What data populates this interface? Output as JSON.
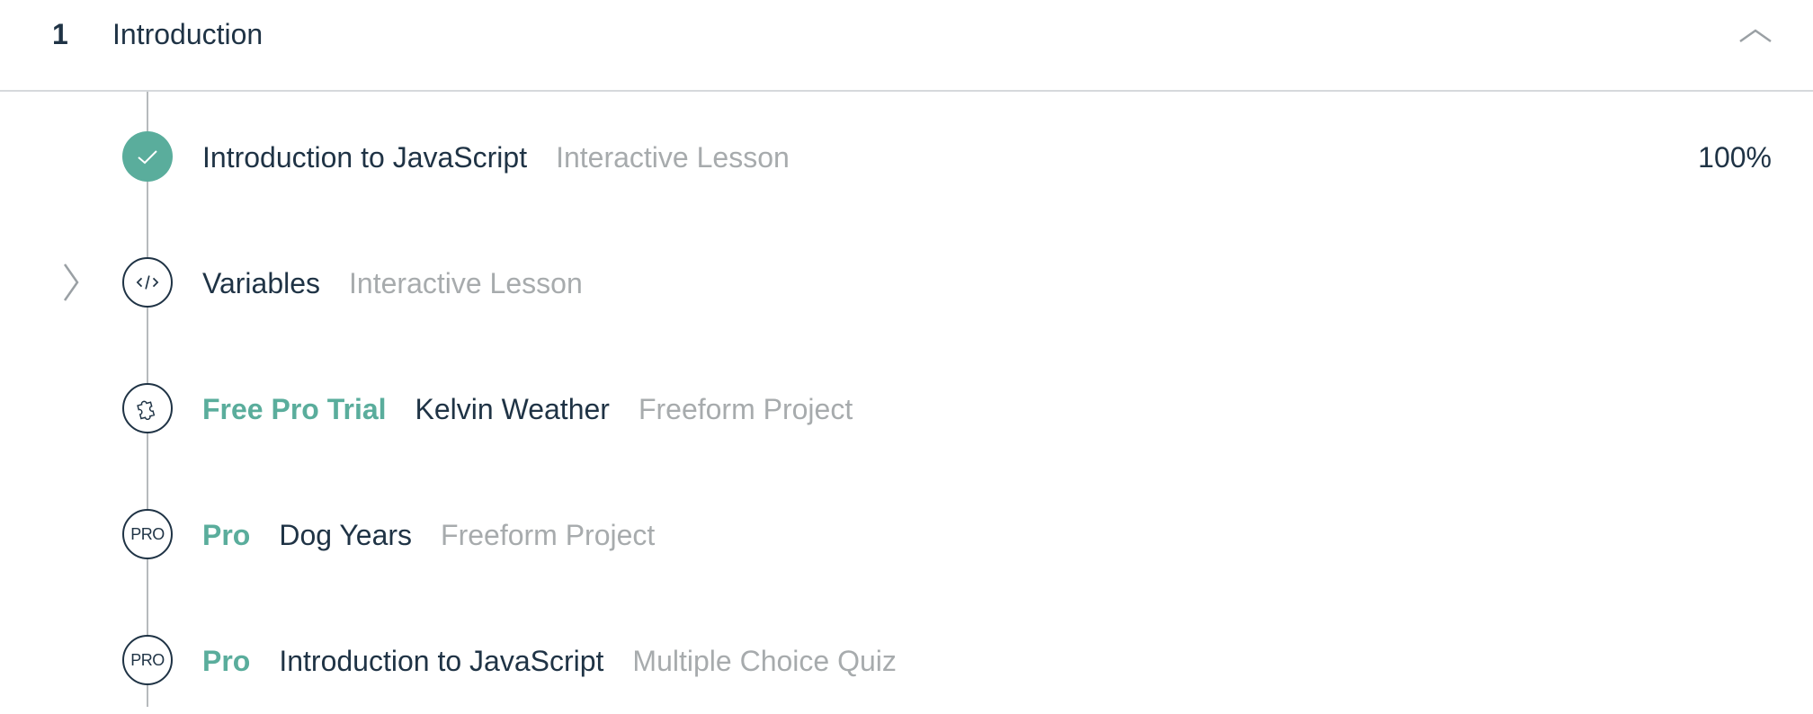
{
  "section": {
    "number": "1",
    "title": "Introduction",
    "collapse_icon": "chevron-up-icon"
  },
  "items": [
    {
      "status": "complete",
      "icon": "checkmark-icon",
      "badge": "",
      "title": "Introduction to JavaScript",
      "type": "Interactive Lesson",
      "progress": "100%"
    },
    {
      "status": "current",
      "icon": "code-icon",
      "badge": "",
      "title": "Variables",
      "type": "Interactive Lesson",
      "progress": ""
    },
    {
      "status": "locked",
      "icon": "puzzle-icon",
      "badge": "Free Pro Trial",
      "title": "Kelvin Weather",
      "type": "Freeform Project",
      "progress": ""
    },
    {
      "status": "locked",
      "icon": "pro-icon",
      "pro_label": "PRO",
      "badge": "Pro",
      "title": "Dog Years",
      "type": "Freeform Project",
      "progress": ""
    },
    {
      "status": "locked",
      "icon": "pro-icon",
      "pro_label": "PRO",
      "badge": "Pro",
      "title": "Introduction to JavaScript",
      "type": "Multiple Choice Quiz",
      "progress": ""
    }
  ],
  "colors": {
    "accent": "#5aad9c",
    "text_dark": "#1f3345",
    "text_muted": "#a7abad",
    "divider": "#d6d9dc"
  }
}
